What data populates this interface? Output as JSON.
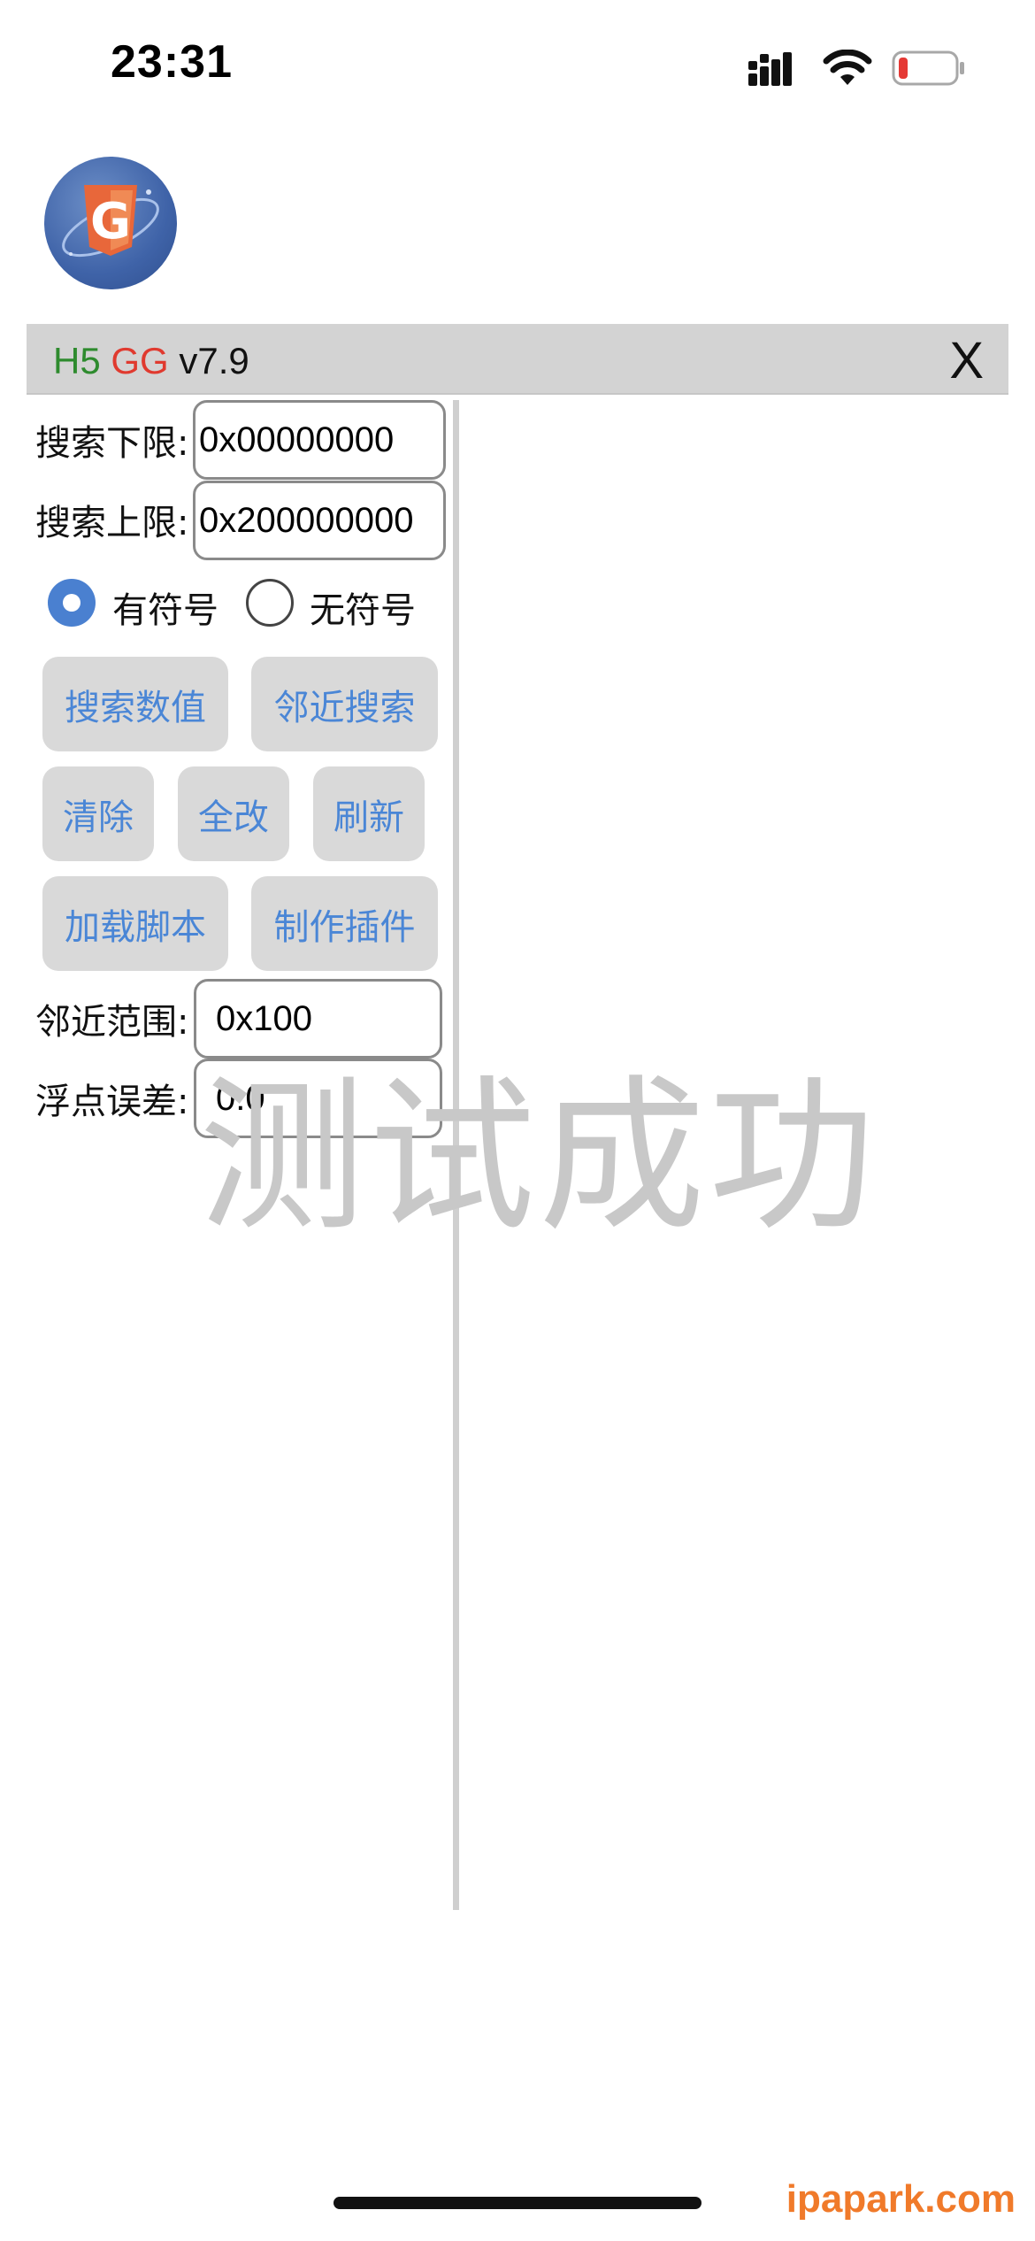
{
  "status_bar": {
    "time": "23:31",
    "icons": [
      "signal-icon",
      "wifi-icon",
      "battery-icon"
    ],
    "battery_color": "#e53935"
  },
  "app_icon": {
    "name": "gg-logo-icon",
    "letter": "G"
  },
  "title_bar": {
    "h5": "H5",
    "gg": "GG",
    "version": " v7.9",
    "close_label": "X",
    "colors": {
      "h5": "#2e8b2e",
      "gg": "#e03a2f"
    }
  },
  "search": {
    "lower_label": "搜索下限:",
    "lower_value": "0x00000000",
    "upper_label": "搜索上限:",
    "upper_value": "0x200000000"
  },
  "sign": {
    "signed_label": "有符号",
    "unsigned_label": "无符号",
    "selected": "signed"
  },
  "buttons": {
    "search_value": "搜索数值",
    "nearby_search": "邻近搜索",
    "clear": "清除",
    "modify_all": "全改",
    "refresh": "刷新",
    "load_script": "加载脚本",
    "make_plugin": "制作插件"
  },
  "nearby": {
    "range_label": "邻近范围:",
    "range_value": "0x100",
    "float_label": "浮点误差:",
    "float_value": "0.0"
  },
  "watermark": "测试成功",
  "site_mark": "ipapark.com",
  "accent_color": "#4a86d6"
}
